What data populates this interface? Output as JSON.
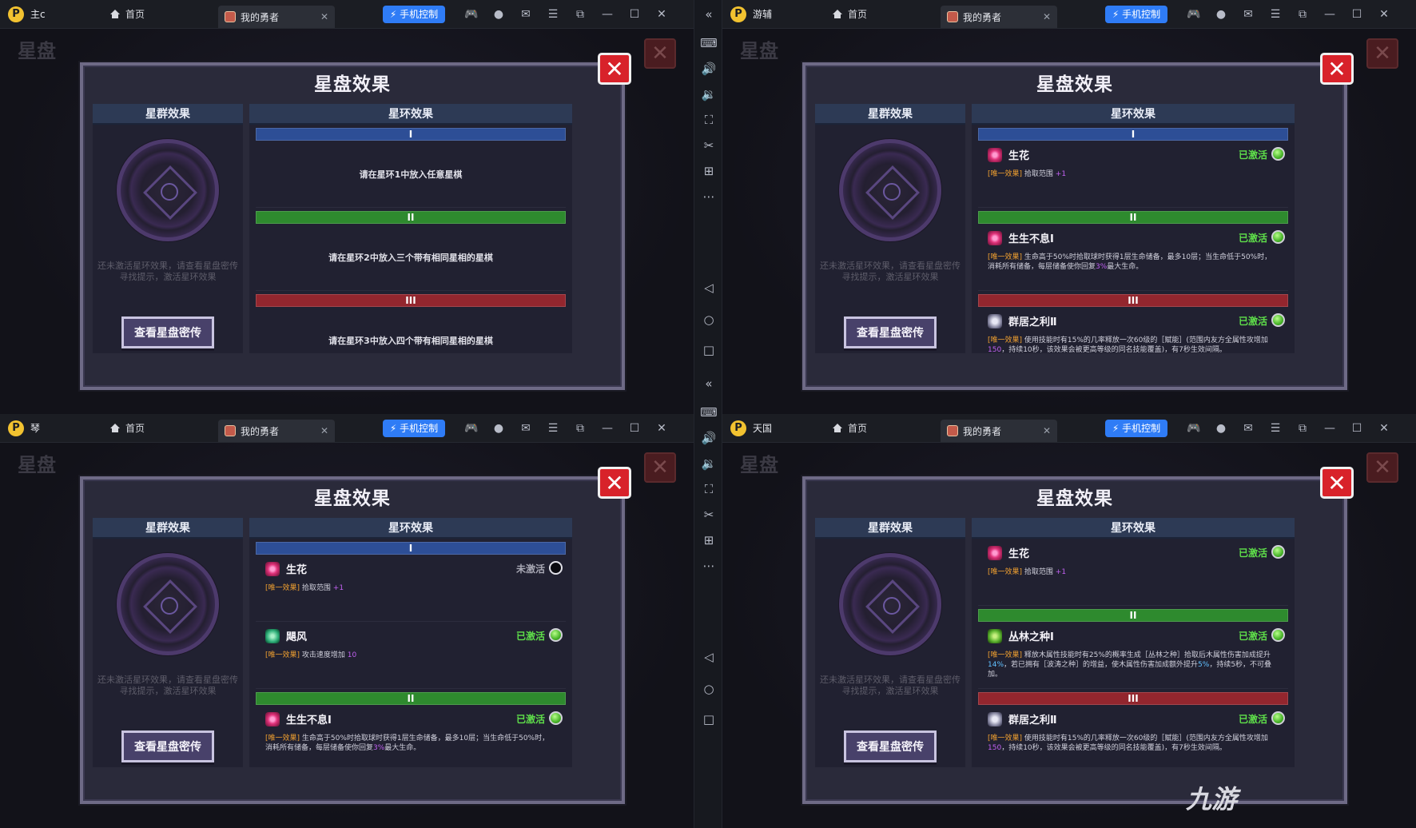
{
  "titlebar": {
    "home_label": "首页",
    "game_tab_label": "我的勇者",
    "phone_control_label": "手机控制"
  },
  "panes": [
    {
      "instance": "主c"
    },
    {
      "instance": "游辅"
    },
    {
      "instance": "琴"
    },
    {
      "instance": "天国"
    }
  ],
  "game": {
    "bg_title": "星盘",
    "panel_title": "星盘效果",
    "left_header": "星群效果",
    "right_header": "星环效果",
    "hint": "还未激活星环效果，请查看星盘密传寻找提示，激活星环效果",
    "view_button": "查看星盘密传",
    "rings": [
      "I",
      "II",
      "III"
    ]
  },
  "status": {
    "active": "已激活",
    "inactive": "未激活"
  },
  "tags": {
    "unique": "[唯一效果]"
  },
  "pane1": {
    "msg1": "请在星环1中放入任意星棋",
    "msg2": "请在星环2中放入三个带有相同星相的星棋",
    "msg3": "请在星环3中放入四个带有相同星相的星棋"
  },
  "effects": {
    "shenghua": {
      "name": "生花",
      "desc": "拾取范围",
      "val": "+1"
    },
    "shengsheng": {
      "name": "生生不息Ⅰ",
      "desc_a": "生命高于50%时拾取球时获得1层生命储备，最多10层；当生命低于50%时，消耗所有储备，每层储备使你回复",
      "val": "3%",
      "desc_b": "最大生命。"
    },
    "qunju": {
      "name": "群居之利Ⅱ",
      "desc_a": "使用技能时有15%的几率释放一次60级的［赋能］(范围内友方全属性攻增加",
      "val": "150",
      "desc_b": "，持续10秒，该效果会被更高等级的同名技能覆盖)，有7秒生效间隔。"
    },
    "jufeng": {
      "name": "飓风",
      "desc": "攻击速度增加",
      "val": "10"
    },
    "conglin": {
      "name": "丛林之种Ⅰ",
      "desc_a": "释放木属性技能时有25%的概率生成［丛林之种］拾取后木属性伤害加成提升",
      "val1": "14%",
      "desc_b": "，若已拥有［波涛之种］的增益，使木属性伤害加成额外提升",
      "val2": "5%",
      "desc_c": "，持续5秒，不可叠加。"
    }
  },
  "sidebar_icons": [
    "keyboard-icon",
    "volume-up-icon",
    "volume-down-icon",
    "screenshot-icon",
    "scissors-icon",
    "add-window-icon",
    "more-icon",
    "back-icon",
    "home-icon",
    "recent-icon"
  ],
  "watermark": "九游"
}
